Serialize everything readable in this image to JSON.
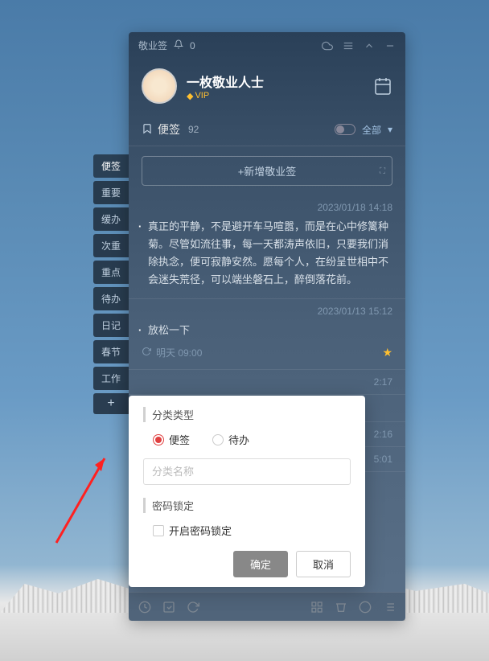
{
  "titlebar": {
    "app_name": "敬业签",
    "notification_count": "0"
  },
  "profile": {
    "username": "一枚敬业人士",
    "vip_label": "VIP"
  },
  "section": {
    "title": "便签",
    "count": "92",
    "filter_label": "全部"
  },
  "add_button": {
    "label": "+新增敬业签"
  },
  "notes": [
    {
      "date": "2023/01/18 14:18",
      "content": "真正的平静，不是避开车马喧嚣，而是在心中修篱种菊。尽管如流往事，每一天都涛声依旧，只要我们消除执念，便可寂静安然。愿每个人，在纷呈世相中不会迷失荒径，可以端坐磐石上，醉倒落花前。"
    },
    {
      "date": "2023/01/13 15:12",
      "content": "放松一下",
      "reminder": "明天 09:00",
      "starred": true
    }
  ],
  "partial_items": [
    {
      "time": "2:17"
    },
    {
      "dots": "。",
      "time": ""
    },
    {
      "time": "2:16"
    },
    {
      "time": "5:01"
    }
  ],
  "side_tabs": [
    "便签",
    "重要",
    "缓办",
    "次重",
    "重点",
    "待办",
    "日记",
    "春节",
    "工作",
    "+"
  ],
  "popup": {
    "category_label": "分类类型",
    "radio_note": "便签",
    "radio_todo": "待办",
    "input_placeholder": "分类名称",
    "lock_label": "密码锁定",
    "checkbox_label": "开启密码锁定",
    "ok_button": "确定",
    "cancel_button": "取消"
  }
}
